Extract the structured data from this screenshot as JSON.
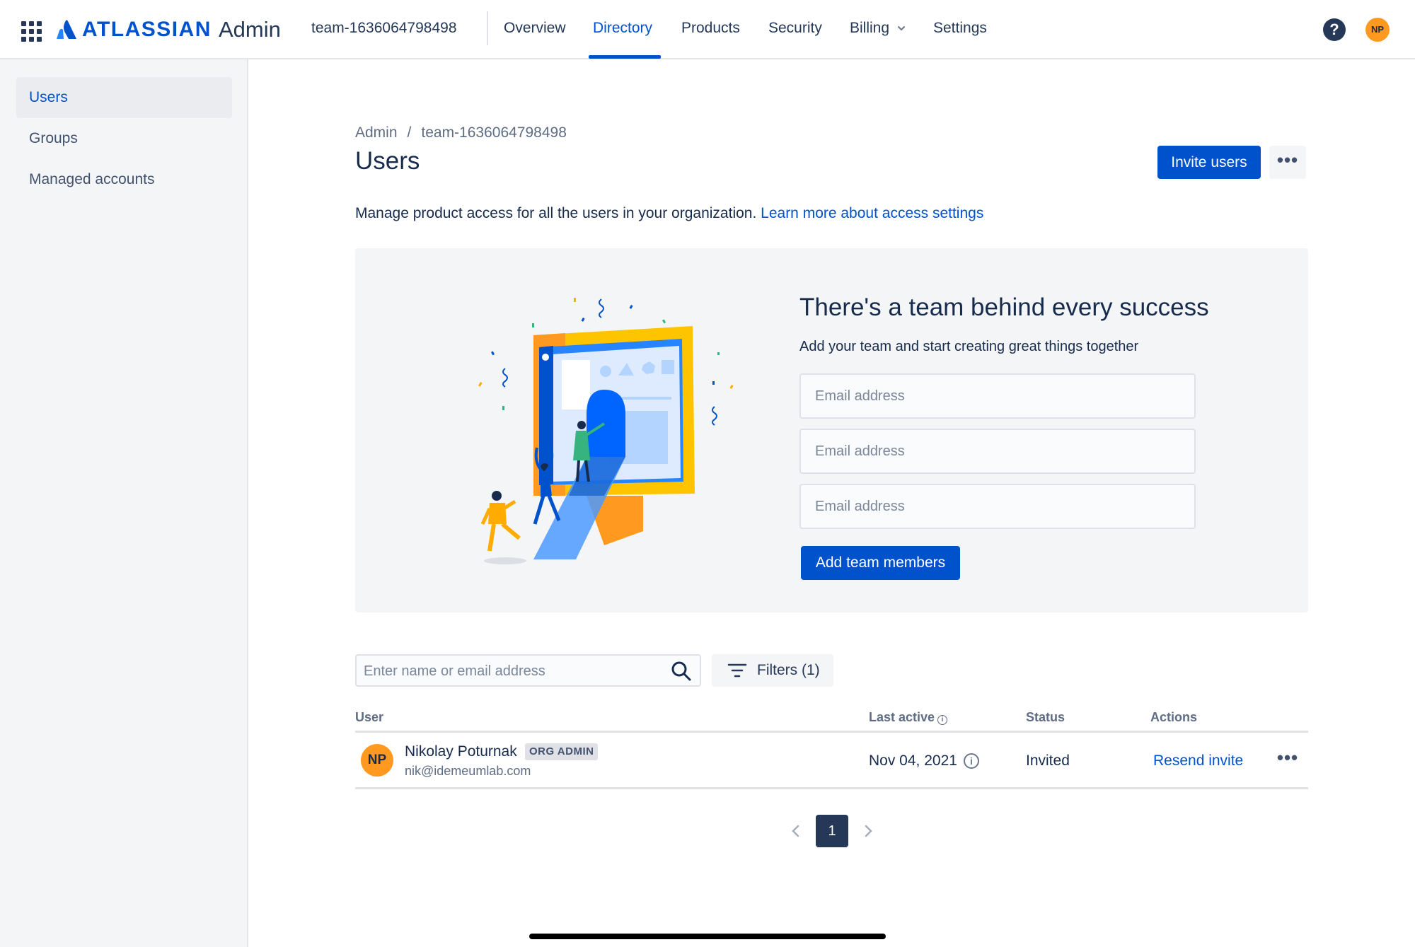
{
  "topnav": {
    "brand": "ATLASSIAN",
    "product": "Admin",
    "org_name": "team-1636064798498",
    "items": [
      {
        "label": "Overview",
        "active": false
      },
      {
        "label": "Directory",
        "active": true
      },
      {
        "label": "Products",
        "active": false
      },
      {
        "label": "Security",
        "active": false
      },
      {
        "label": "Billing",
        "active": false,
        "has_dropdown": true
      },
      {
        "label": "Settings",
        "active": false
      }
    ],
    "help_glyph": "?",
    "avatar_initials": "NP",
    "icons": [
      "apps-grid-icon",
      "atlassian-logo-icon",
      "chevron-down-icon",
      "help-icon"
    ]
  },
  "sidebar": {
    "items": [
      {
        "label": "Users",
        "active": true
      },
      {
        "label": "Groups",
        "active": false
      },
      {
        "label": "Managed accounts",
        "active": false
      }
    ]
  },
  "breadcrumb": {
    "items": [
      "Admin",
      "team-1636064798498"
    ],
    "separator": "/"
  },
  "page": {
    "title": "Users",
    "invite_button": "Invite users",
    "more_glyph": "•••",
    "description": "Manage product access for all the users in your organization.",
    "learn_more_link": "Learn more about access settings"
  },
  "team_panel": {
    "title": "There's a team behind every success",
    "subtitle": "Add your team and start creating great things together",
    "email_placeholder": "Email address",
    "email_values": [
      "",
      "",
      ""
    ],
    "add_button": "Add team members"
  },
  "search": {
    "placeholder": "Enter name or email address",
    "value": ""
  },
  "filters": {
    "label": "Filters (1)"
  },
  "table": {
    "columns": [
      "User",
      "Last active",
      "Status",
      "Actions"
    ],
    "rows": [
      {
        "avatar_initials": "NP",
        "name": "Nikolay Poturnak",
        "badge": "ORG ADMIN",
        "email": "nik@idemeumlab.com",
        "last_active": "Nov 04, 2021",
        "status": "Invited",
        "action": "Resend invite",
        "more_glyph": "•••"
      }
    ]
  },
  "pagination": {
    "current_page": "1",
    "pages": [
      "1"
    ]
  },
  "colors": {
    "primary": "#0052cc",
    "text": "#172b4d",
    "avatar": "#ff991f",
    "panel_bg": "#f4f5f7"
  }
}
